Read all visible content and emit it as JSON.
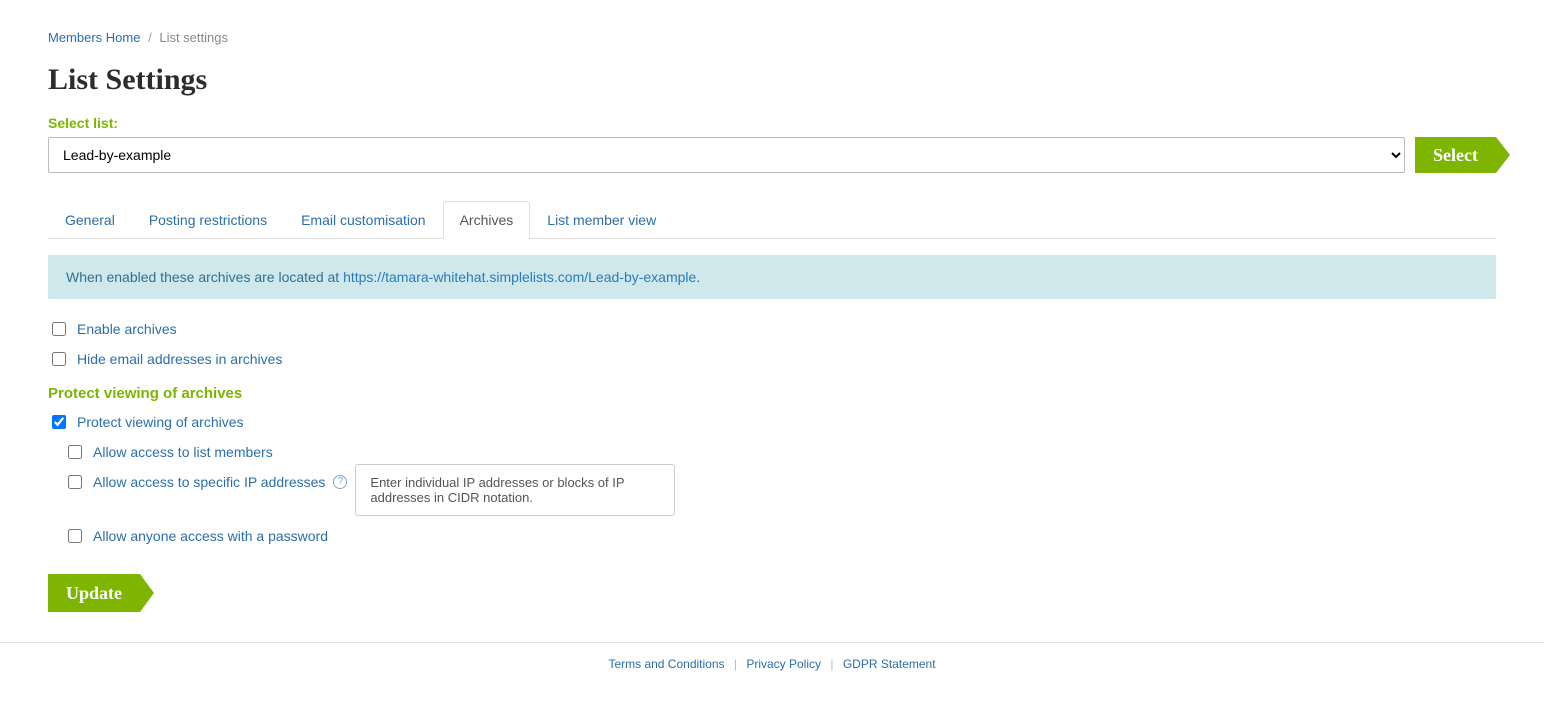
{
  "breadcrumb": {
    "home": "Members Home",
    "current": "List settings"
  },
  "page_title": "List Settings",
  "select_list_label": "Select list:",
  "selected_list": "Lead-by-example",
  "select_button": "Select",
  "tabs": {
    "general": "General",
    "posting": "Posting restrictions",
    "email": "Email customisation",
    "archives": "Archives",
    "member_view": "List member view"
  },
  "info": {
    "prefix": "When enabled these archives are located at ",
    "url": "https://tamara-whitehat.simplelists.com/Lead-by-example",
    "suffix": "."
  },
  "checkboxes": {
    "enable_archives": "Enable archives",
    "hide_email": "Hide email addresses in archives",
    "protect_viewing": "Protect viewing of archives",
    "allow_members": "Allow access to list members",
    "allow_ip": "Allow access to specific IP addresses",
    "allow_password": "Allow anyone access with a password"
  },
  "section_heading": "Protect viewing of archives",
  "tooltip_text": "Enter individual IP addresses or blocks of IP addresses in CIDR notation.",
  "help_glyph": "?",
  "update_button": "Update",
  "footer": {
    "terms": "Terms and Conditions",
    "privacy": "Privacy Policy",
    "gdpr": "GDPR Statement"
  }
}
